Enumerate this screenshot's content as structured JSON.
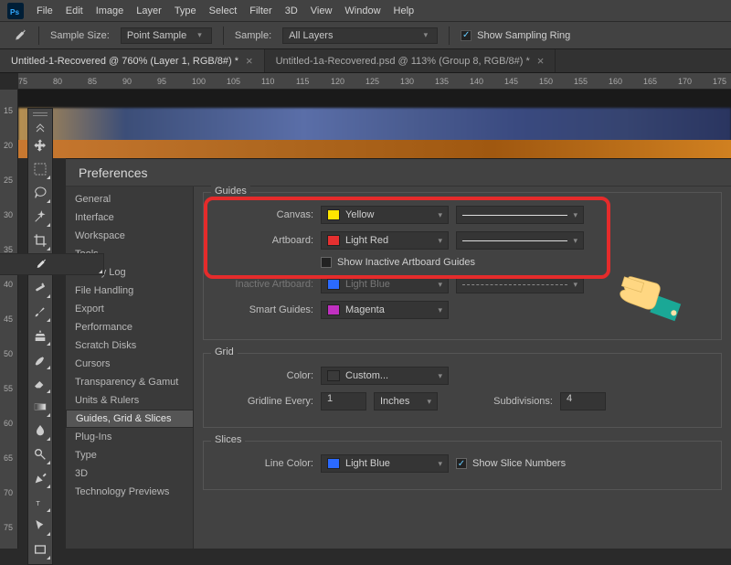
{
  "menubar": {
    "items": [
      "File",
      "Edit",
      "Image",
      "Layer",
      "Type",
      "Select",
      "Filter",
      "3D",
      "View",
      "Window",
      "Help"
    ]
  },
  "optionbar": {
    "sample_size_label": "Sample Size:",
    "sample_size_value": "Point Sample",
    "sample_label": "Sample:",
    "sample_value": "All Layers",
    "show_sampling_ring": "Show Sampling Ring"
  },
  "tabs": [
    {
      "title": "Untitled-1-Recovered @ 760% (Layer 1, RGB/8#) *",
      "active": true
    },
    {
      "title": "Untitled-1a-Recovered.psd @ 113% (Group 8, RGB/8#) *",
      "active": false
    }
  ],
  "ruler_h": [
    "75",
    "80",
    "85",
    "90",
    "95",
    "100",
    "105",
    "110",
    "115",
    "120",
    "125",
    "130",
    "135",
    "140",
    "145",
    "150",
    "155",
    "160",
    "165",
    "170",
    "175"
  ],
  "ruler_v": [
    "15",
    "20",
    "25",
    "30",
    "35",
    "40",
    "45",
    "50",
    "55",
    "60",
    "65",
    "70",
    "75"
  ],
  "prefs": {
    "title": "Preferences",
    "categories": [
      "General",
      "Interface",
      "Workspace",
      "Tools",
      "History Log",
      "File Handling",
      "Export",
      "Performance",
      "Scratch Disks",
      "Cursors",
      "Transparency & Gamut",
      "Units & Rulers",
      "Guides, Grid & Slices",
      "Plug-Ins",
      "Type",
      "3D",
      "Technology Previews"
    ],
    "selected_category": "Guides, Grid & Slices",
    "guides_label": "Guides",
    "canvas_label": "Canvas:",
    "canvas_value": "Yellow",
    "canvas_swatch": "#ffe600",
    "artboard_label": "Artboard:",
    "artboard_value": "Light Red",
    "artboard_swatch": "#e53030",
    "show_inactive_label": "Show Inactive Artboard Guides",
    "inactive_label": "Inactive Artboard:",
    "inactive_value": "Light Blue",
    "inactive_swatch": "#2b6aff",
    "smart_label": "Smart Guides:",
    "smart_value": "Magenta",
    "smart_swatch": "#c030c0",
    "grid_label": "Grid",
    "grid_color_label": "Color:",
    "grid_color_value": "Custom...",
    "grid_color_swatch": "#3a3a3a",
    "gridline_label": "Gridline Every:",
    "gridline_value": "1",
    "gridline_unit": "Inches",
    "subdiv_label": "Subdivisions:",
    "subdiv_value": "4",
    "slices_label": "Slices",
    "line_color_label": "Line Color:",
    "line_color_value": "Light Blue",
    "line_color_swatch": "#2b6aff",
    "show_slice_numbers": "Show Slice Numbers"
  }
}
